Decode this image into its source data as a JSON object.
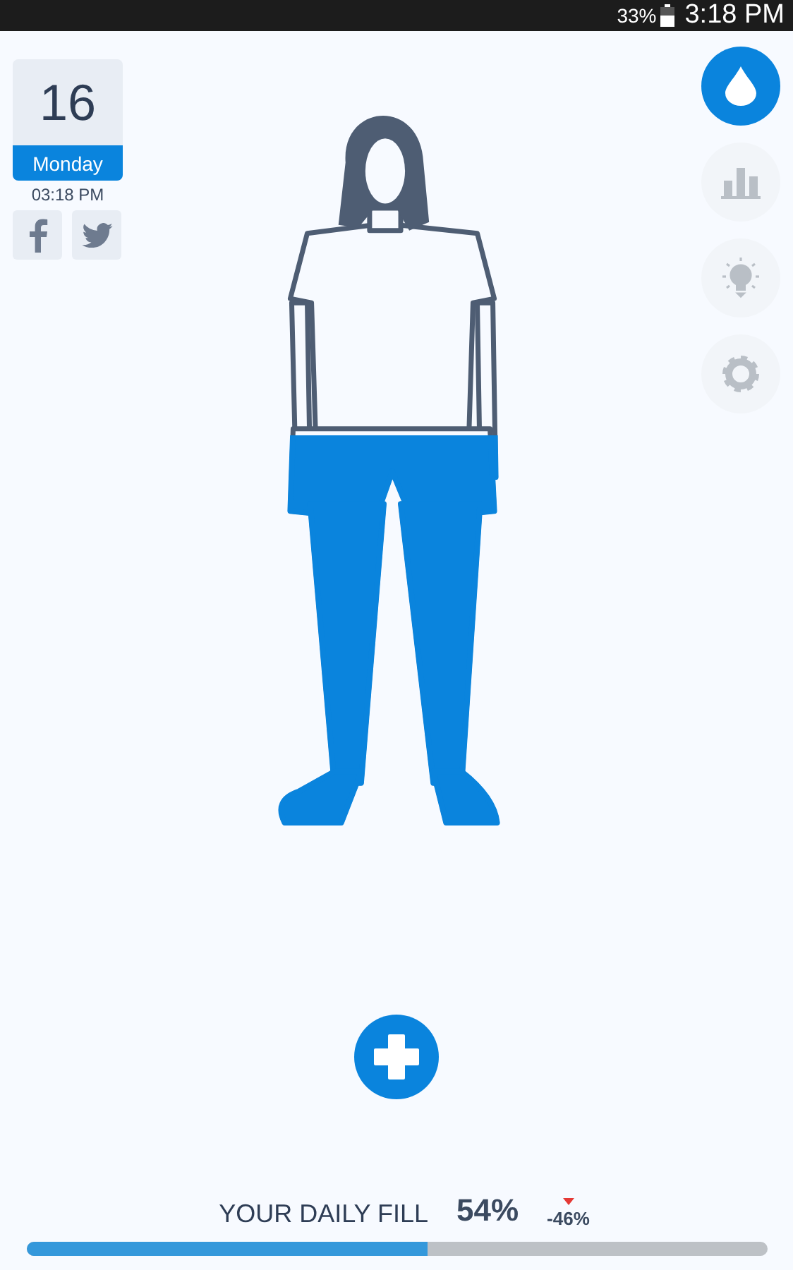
{
  "status_bar": {
    "battery": "33%",
    "time": "3:18 PM"
  },
  "date_card": {
    "day": "16",
    "weekday": "Monday",
    "time": "03:18 PM"
  },
  "social": [
    {
      "kind": "facebook"
    },
    {
      "kind": "twitter"
    }
  ],
  "nav": [
    {
      "kind": "water",
      "selected": true
    },
    {
      "kind": "stats",
      "selected": false
    },
    {
      "kind": "tips",
      "selected": false
    },
    {
      "kind": "settings",
      "selected": false
    }
  ],
  "daily_fill": {
    "label": "YOUR DAILY FILL",
    "value": "54%",
    "change": "-46%",
    "falling": true,
    "level": 0.54
  }
}
